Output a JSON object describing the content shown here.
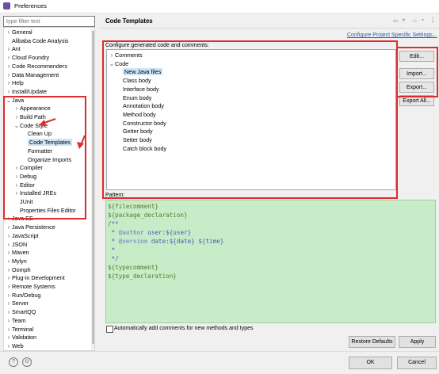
{
  "window": {
    "title": "Preferences"
  },
  "filter": {
    "placeholder": "type filter text"
  },
  "tree": [
    {
      "label": "General",
      "arrow": ">",
      "indent": 0
    },
    {
      "label": "Alibaba Code Analysis",
      "arrow": "",
      "indent": 0
    },
    {
      "label": "Ant",
      "arrow": ">",
      "indent": 0
    },
    {
      "label": "Cloud Foundry",
      "arrow": ">",
      "indent": 0
    },
    {
      "label": "Code Recommenders",
      "arrow": ">",
      "indent": 0
    },
    {
      "label": "Data Management",
      "arrow": ">",
      "indent": 0
    },
    {
      "label": "Help",
      "arrow": ">",
      "indent": 0
    },
    {
      "label": "Install/Update",
      "arrow": ">",
      "indent": 0
    },
    {
      "label": "Java",
      "arrow": "v",
      "indent": 0
    },
    {
      "label": "Appearance",
      "arrow": ">",
      "indent": 1
    },
    {
      "label": "Build Path",
      "arrow": ">",
      "indent": 1
    },
    {
      "label": "Code Style",
      "arrow": "v",
      "indent": 1
    },
    {
      "label": "Clean Up",
      "arrow": "",
      "indent": 2
    },
    {
      "label": "Code Templates",
      "arrow": "",
      "indent": 2,
      "selected": true
    },
    {
      "label": "Formatter",
      "arrow": "",
      "indent": 2
    },
    {
      "label": "Organize Imports",
      "arrow": "",
      "indent": 2
    },
    {
      "label": "Compiler",
      "arrow": ">",
      "indent": 1
    },
    {
      "label": "Debug",
      "arrow": ">",
      "indent": 1
    },
    {
      "label": "Editor",
      "arrow": ">",
      "indent": 1
    },
    {
      "label": "Installed JREs",
      "arrow": ">",
      "indent": 1
    },
    {
      "label": "JUnit",
      "arrow": "",
      "indent": 1
    },
    {
      "label": "Properties Files Editor",
      "arrow": "",
      "indent": 1
    },
    {
      "label": "Java EE",
      "arrow": ">",
      "indent": 0
    },
    {
      "label": "Java Persistence",
      "arrow": ">",
      "indent": 0
    },
    {
      "label": "JavaScript",
      "arrow": ">",
      "indent": 0
    },
    {
      "label": "JSON",
      "arrow": ">",
      "indent": 0
    },
    {
      "label": "Maven",
      "arrow": ">",
      "indent": 0
    },
    {
      "label": "Mylyn",
      "arrow": ">",
      "indent": 0
    },
    {
      "label": "Oomph",
      "arrow": ">",
      "indent": 0
    },
    {
      "label": "Plug-in Development",
      "arrow": ">",
      "indent": 0
    },
    {
      "label": "Remote Systems",
      "arrow": ">",
      "indent": 0
    },
    {
      "label": "Run/Debug",
      "arrow": ">",
      "indent": 0
    },
    {
      "label": "Server",
      "arrow": ">",
      "indent": 0
    },
    {
      "label": "SmartQQ",
      "arrow": ">",
      "indent": 0
    },
    {
      "label": "Team",
      "arrow": ">",
      "indent": 0
    },
    {
      "label": "Terminal",
      "arrow": ">",
      "indent": 0
    },
    {
      "label": "Validation",
      "arrow": ">",
      "indent": 0
    },
    {
      "label": "Web",
      "arrow": ">",
      "indent": 0
    }
  ],
  "page": {
    "title": "Code Templates",
    "config_link": "Configure Project Specific Settings...",
    "config_label": "Configure generated code and comments:",
    "pattern_label": "Pattern:",
    "auto_label": "Automatically add comments for new methods and types"
  },
  "templates": [
    {
      "label": "Comments",
      "arrow": ">",
      "indent": 0
    },
    {
      "label": "Code",
      "arrow": "v",
      "indent": 0
    },
    {
      "label": "New Java files",
      "arrow": "",
      "indent": 1,
      "selected": true
    },
    {
      "label": "Class body",
      "arrow": "",
      "indent": 1
    },
    {
      "label": "Interface body",
      "arrow": "",
      "indent": 1
    },
    {
      "label": "Enum body",
      "arrow": "",
      "indent": 1
    },
    {
      "label": "Annotation body",
      "arrow": "",
      "indent": 1
    },
    {
      "label": "Method body",
      "arrow": "",
      "indent": 1
    },
    {
      "label": "Constructor body",
      "arrow": "",
      "indent": 1
    },
    {
      "label": "Getter body",
      "arrow": "",
      "indent": 1
    },
    {
      "label": "Setter body",
      "arrow": "",
      "indent": 1
    },
    {
      "label": "Catch block body",
      "arrow": "",
      "indent": 1
    }
  ],
  "side_buttons": {
    "edit": "Edit...",
    "import": "Import...",
    "export": "Export...",
    "export_all": "Export All..."
  },
  "pattern_lines": [
    [
      {
        "t": "${filecomment}",
        "c": "var"
      }
    ],
    [
      {
        "t": "${package_declaration}",
        "c": "var"
      }
    ],
    [
      {
        "t": "/**",
        "c": "com"
      }
    ],
    [
      {
        "t": " * ",
        "c": "com"
      },
      {
        "t": "@author",
        "c": "tag"
      },
      {
        "t": " user:${user}",
        "c": "com"
      }
    ],
    [
      {
        "t": " * ",
        "c": "com"
      },
      {
        "t": "@version",
        "c": "tag"
      },
      {
        "t": " date:${date} ${time}",
        "c": "com"
      }
    ],
    [
      {
        "t": " *",
        "c": "com"
      }
    ],
    [
      {
        "t": " */",
        "c": "com"
      }
    ],
    [
      {
        "t": "${typecomment}",
        "c": "var"
      }
    ],
    [
      {
        "t": "${type_declaration}",
        "c": "var"
      }
    ]
  ],
  "buttons": {
    "restore": "Restore Defaults",
    "apply": "Apply",
    "ok": "OK",
    "cancel": "Cancel"
  },
  "colors": {
    "accent_red": "#e02b2b",
    "pattern_bg": "#c8ecc8",
    "selection": "#cce4f7",
    "link": "#2c5fa1"
  },
  "icons": {
    "app": "eclipse-preferences-icon",
    "help": "help-icon",
    "import_export": "import-export-icon"
  }
}
